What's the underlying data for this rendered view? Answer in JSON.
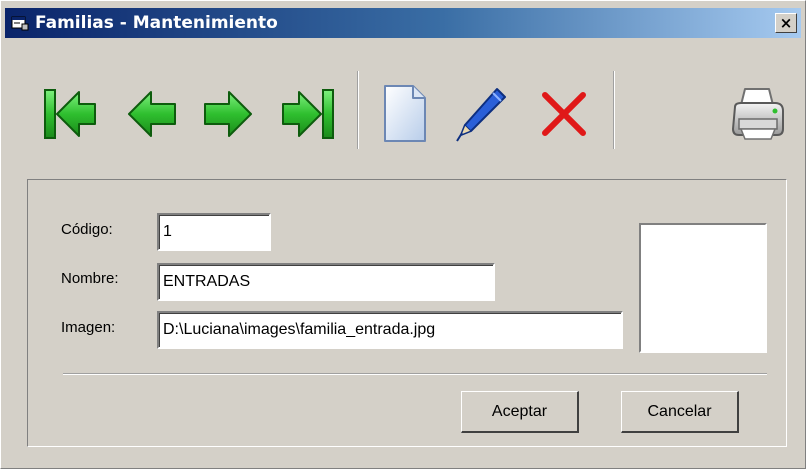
{
  "window": {
    "title": "Familias - Mantenimiento",
    "close_label": "×"
  },
  "toolbar": {
    "buttons": [
      {
        "name": "first-record",
        "icon": "first-arrow-icon"
      },
      {
        "name": "previous-record",
        "icon": "left-arrow-icon"
      },
      {
        "name": "next-record",
        "icon": "right-arrow-icon"
      },
      {
        "name": "last-record",
        "icon": "last-arrow-icon"
      },
      {
        "name": "new-record",
        "icon": "new-document-icon"
      },
      {
        "name": "edit-record",
        "icon": "pen-icon"
      },
      {
        "name": "delete-record",
        "icon": "delete-x-icon"
      },
      {
        "name": "print",
        "icon": "printer-icon"
      }
    ],
    "colors": {
      "arrow_green": "#2fbf2f",
      "delete_red": "#e01818",
      "pen_blue": "#2a5fd8"
    }
  },
  "form": {
    "codigo_label": "Código:",
    "codigo_value": "1",
    "nombre_label": "Nombre:",
    "nombre_value": "ENTRADAS",
    "imagen_label": "Imagen:",
    "imagen_value": "D:\\Luciana\\images\\familia_entrada.jpg"
  },
  "actions": {
    "accept_label": "Aceptar",
    "cancel_label": "Cancelar"
  }
}
